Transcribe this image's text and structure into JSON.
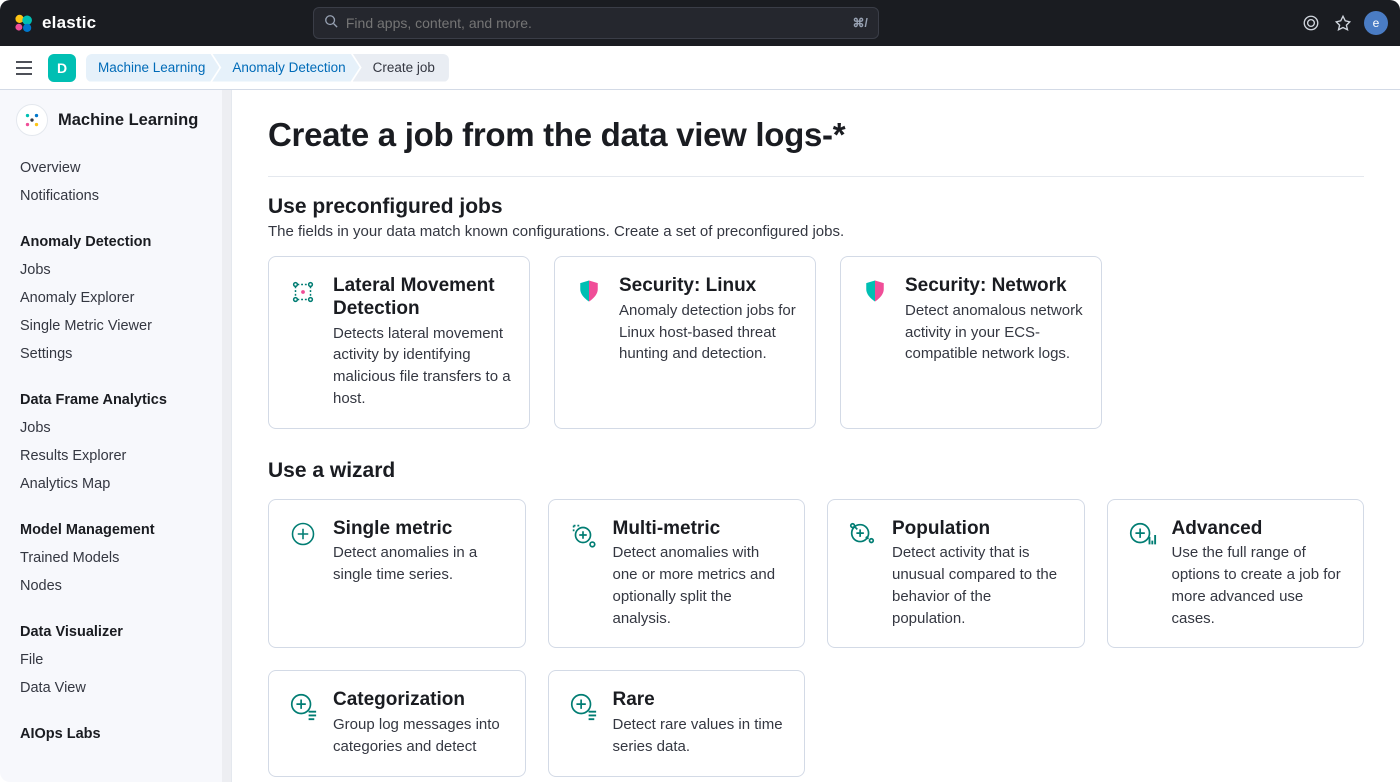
{
  "header": {
    "brand": "elastic",
    "search_placeholder": "Find apps, content, and more.",
    "search_shortcut": "⌘/",
    "avatar_initial": "e"
  },
  "subbar": {
    "space_initial": "D",
    "breadcrumbs": [
      {
        "label": "Machine Learning",
        "link": true
      },
      {
        "label": "Anomaly Detection",
        "link": true
      },
      {
        "label": "Create job",
        "link": false
      }
    ]
  },
  "sidebar": {
    "title": "Machine Learning",
    "groups": [
      {
        "title": null,
        "items": [
          "Overview",
          "Notifications"
        ]
      },
      {
        "title": "Anomaly Detection",
        "items": [
          "Jobs",
          "Anomaly Explorer",
          "Single Metric Viewer",
          "Settings"
        ]
      },
      {
        "title": "Data Frame Analytics",
        "items": [
          "Jobs",
          "Results Explorer",
          "Analytics Map"
        ]
      },
      {
        "title": "Model Management",
        "items": [
          "Trained Models",
          "Nodes"
        ]
      },
      {
        "title": "Data Visualizer",
        "items": [
          "File",
          "Data View"
        ]
      },
      {
        "title": "AIOps Labs",
        "items": []
      }
    ]
  },
  "main": {
    "title": "Create a job from the data view logs-*",
    "preconf": {
      "heading": "Use preconfigured jobs",
      "sub": "The fields in your data match known configurations. Create a set of preconfigured jobs.",
      "cards": [
        {
          "title": "Lateral Movement Detection",
          "desc": "Detects lateral movement activity by identifying malicious file transfers to a host.",
          "icon": "dots"
        },
        {
          "title": "Security: Linux",
          "desc": "Anomaly detection jobs for Linux host-based threat hunting and detection.",
          "icon": "shield"
        },
        {
          "title": "Security: Network",
          "desc": "Detect anomalous network activity in your ECS-compatible network logs.",
          "icon": "shield"
        }
      ]
    },
    "wizard": {
      "heading": "Use a wizard",
      "cards": [
        {
          "title": "Single metric",
          "desc": "Detect anomalies in a single time series.",
          "icon": "plus-circle"
        },
        {
          "title": "Multi-metric",
          "desc": "Detect anomalies with one or more metrics and optionally split the analysis.",
          "icon": "multi"
        },
        {
          "title": "Population",
          "desc": "Detect activity that is unusual compared to the behavior of the population.",
          "icon": "pop"
        },
        {
          "title": "Advanced",
          "desc": "Use the full range of options to create a job for more advanced use cases.",
          "icon": "adv"
        },
        {
          "title": "Categorization",
          "desc": "Group log messages into categories and detect",
          "icon": "cat"
        },
        {
          "title": "Rare",
          "desc": "Detect rare values in time series data.",
          "icon": "rare"
        }
      ]
    }
  }
}
